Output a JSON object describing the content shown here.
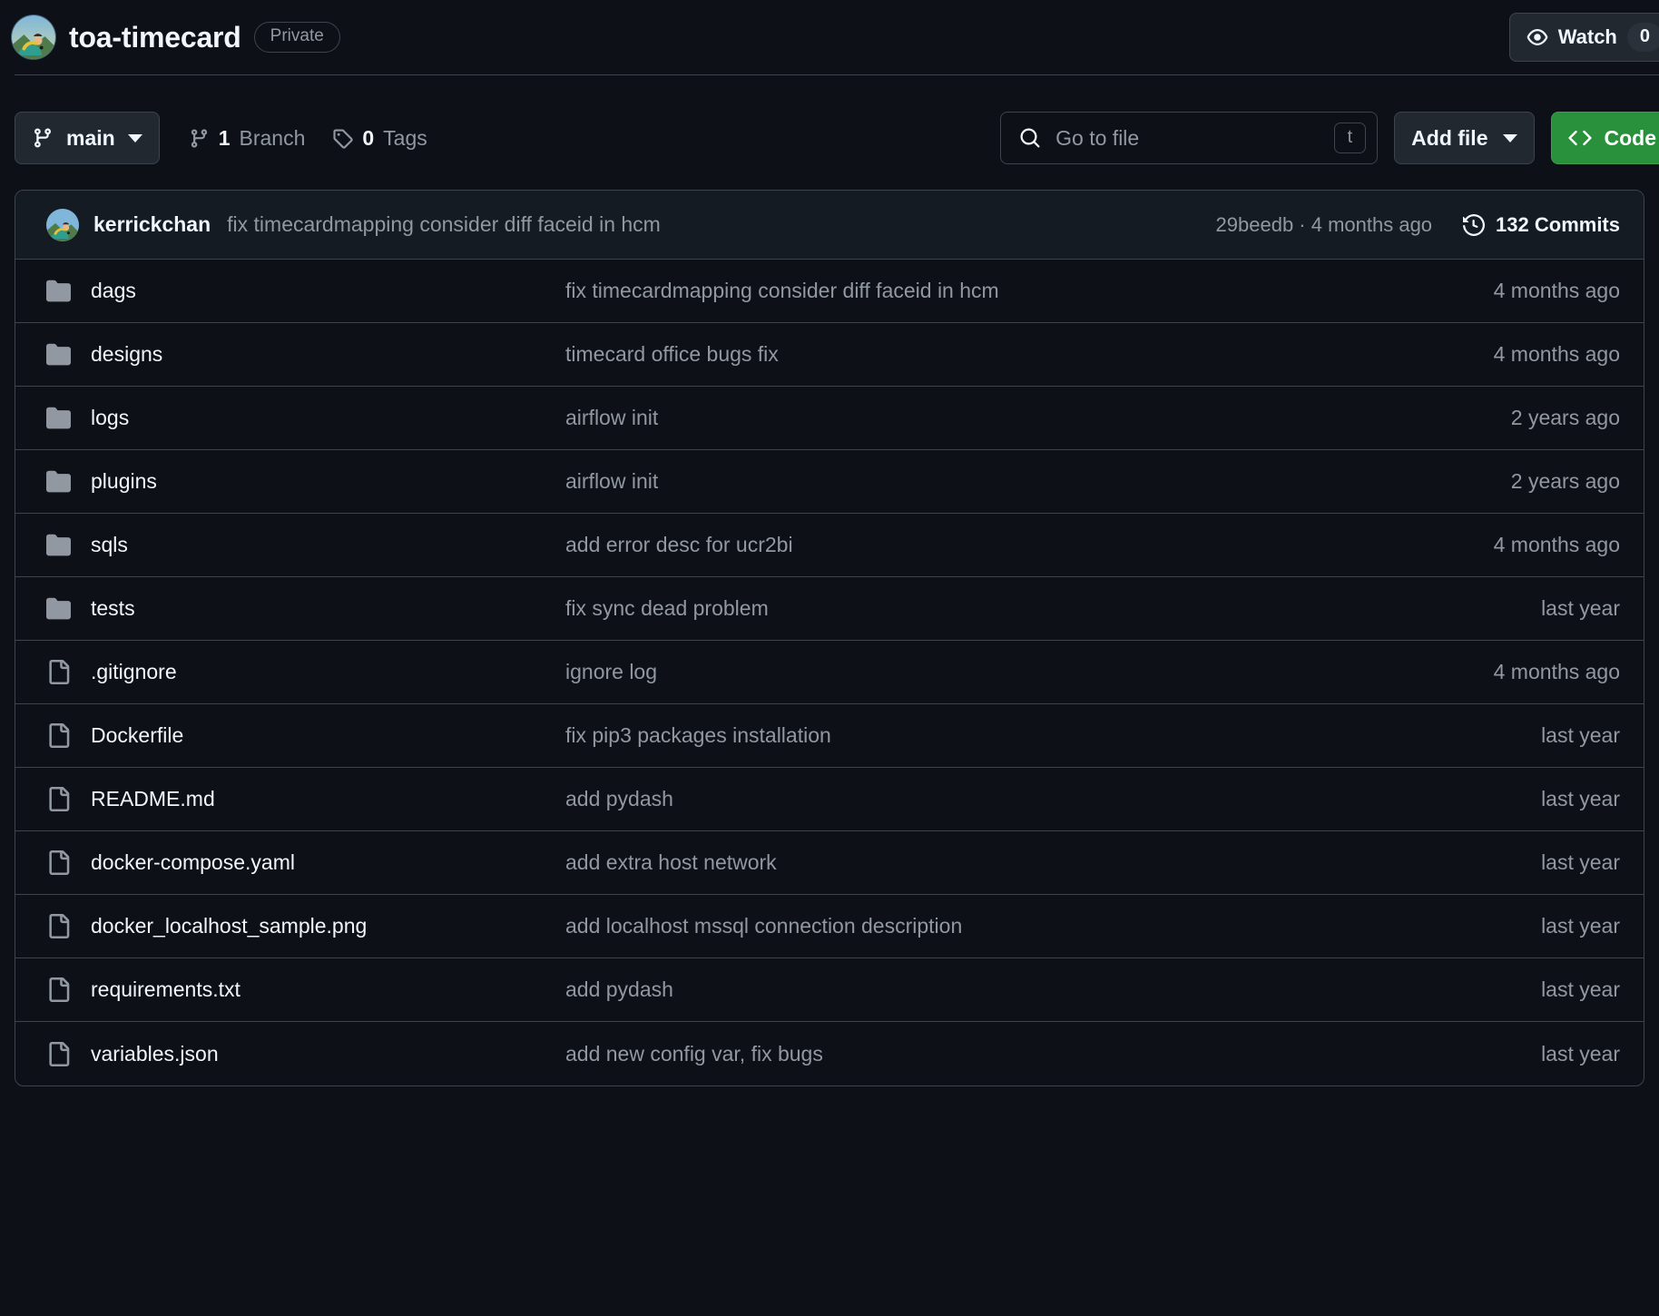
{
  "header": {
    "repo_name": "toa-timecard",
    "visibility": "Private",
    "avatar_icon": "owner-avatar-image",
    "watch": {
      "label": "Watch",
      "count": "0",
      "eye_icon": "eye-icon",
      "caret_icon": "chevron-down-icon"
    }
  },
  "toolbar": {
    "branch": {
      "name": "main",
      "branch_icon": "git-branch-icon",
      "caret_icon": "chevron-down-icon"
    },
    "branch_count": "1",
    "branch_count_label": "Branch",
    "tag_count": "0",
    "tag_count_label": "Tags",
    "tag_icon": "tag-icon",
    "search": {
      "placeholder": "Go to file",
      "value": "",
      "search_icon": "search-icon",
      "shortcut": "t"
    },
    "add_file_label": "Add file",
    "code_label": "Code",
    "code_icon": "code-brackets-icon"
  },
  "commit_bar": {
    "author": "kerrickchan",
    "message": "fix timecardmapping consider diff faceid in hcm",
    "hash_and_time": "29beedb · 4 months ago",
    "commits_count": "132 Commits",
    "history_icon": "history-clock-icon",
    "avatar_icon": "commit-author-avatar"
  },
  "files": [
    {
      "type": "folder",
      "name": "dags",
      "message": "fix timecardmapping consider diff faceid in hcm",
      "age": "4 months ago"
    },
    {
      "type": "folder",
      "name": "designs",
      "message": "timecard office bugs fix",
      "age": "4 months ago"
    },
    {
      "type": "folder",
      "name": "logs",
      "message": "airflow init",
      "age": "2 years ago"
    },
    {
      "type": "folder",
      "name": "plugins",
      "message": "airflow init",
      "age": "2 years ago"
    },
    {
      "type": "folder",
      "name": "sqls",
      "message": "add error desc for ucr2bi",
      "age": "4 months ago"
    },
    {
      "type": "folder",
      "name": "tests",
      "message": "fix sync dead problem",
      "age": "last year"
    },
    {
      "type": "file",
      "name": ".gitignore",
      "message": "ignore log",
      "age": "4 months ago"
    },
    {
      "type": "file",
      "name": "Dockerfile",
      "message": "fix pip3 packages installation",
      "age": "last year"
    },
    {
      "type": "file",
      "name": "README.md",
      "message": "add pydash",
      "age": "last year"
    },
    {
      "type": "file",
      "name": "docker-compose.yaml",
      "message": "add extra host network",
      "age": "last year"
    },
    {
      "type": "file",
      "name": "docker_localhost_sample.png",
      "message": "add localhost mssql connection description",
      "age": "last year"
    },
    {
      "type": "file",
      "name": "requirements.txt",
      "message": "add pydash",
      "age": "last year"
    },
    {
      "type": "file",
      "name": "variables.json",
      "message": "add new config var, fix bugs",
      "age": "last year"
    }
  ],
  "colors": {
    "page_bg": "#0d1117",
    "panel_bg": "#151b23",
    "border": "#3d444d",
    "text_primary": "#f0f6fc",
    "text_muted": "#9198a1",
    "accent_green": "#29903b"
  }
}
